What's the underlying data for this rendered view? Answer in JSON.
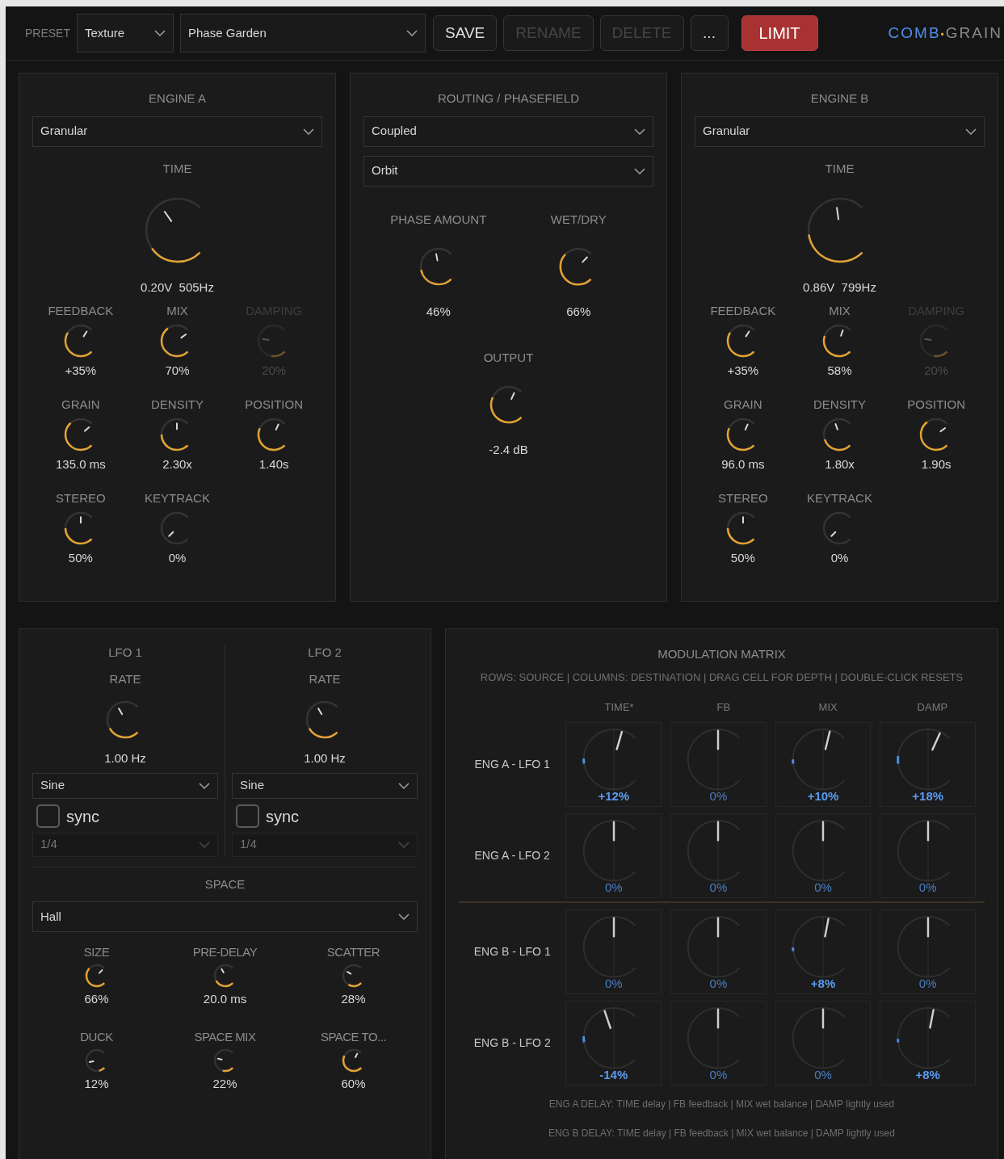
{
  "top_bar": {
    "preset_label": "PRESET",
    "bank": "Texture",
    "preset": "Phase Garden",
    "buttons": [
      {
        "label": "SAVE",
        "kind": "normal",
        "disabled": false
      },
      {
        "label": "RENAME",
        "kind": "normal",
        "disabled": true
      },
      {
        "label": "DELETE",
        "kind": "normal",
        "disabled": true
      },
      {
        "label": "...",
        "kind": "normal",
        "disabled": false
      },
      {
        "label": "LIMIT",
        "kind": "alert",
        "disabled": false
      }
    ],
    "logo": {
      "left": "COMB",
      "separator": "•",
      "right": "GRAIN"
    }
  },
  "engines": [
    {
      "title": "ENGINE A",
      "mode": "Granular",
      "time": {
        "label": "TIME",
        "value": "0.20V  505Hz"
      },
      "knobs": [
        {
          "label": "FEEDBACK",
          "value": "+35%",
          "disabled": false
        },
        {
          "label": "MIX",
          "value": "70%",
          "disabled": false
        },
        {
          "label": "DAMPING",
          "value": "20%",
          "disabled": true
        },
        {
          "label": "GRAIN",
          "value": "135.0 ms",
          "disabled": false
        },
        {
          "label": "DENSITY",
          "value": "2.30x",
          "disabled": false
        },
        {
          "label": "POSITION",
          "value": "1.40s",
          "disabled": false
        },
        {
          "label": "STEREO",
          "value": "50%",
          "disabled": false
        },
        {
          "label": "KEYTRACK",
          "value": "0%",
          "disabled": false
        }
      ]
    },
    {
      "title": "ENGINE B",
      "mode": "Granular",
      "time": {
        "label": "TIME",
        "value": "0.86V  799Hz"
      },
      "knobs": [
        {
          "label": "FEEDBACK",
          "value": "+35%",
          "disabled": false
        },
        {
          "label": "MIX",
          "value": "58%",
          "disabled": false
        },
        {
          "label": "DAMPING",
          "value": "20%",
          "disabled": true
        },
        {
          "label": "GRAIN",
          "value": "96.0 ms",
          "disabled": false
        },
        {
          "label": "DENSITY",
          "value": "1.80x",
          "disabled": false
        },
        {
          "label": "POSITION",
          "value": "1.90s",
          "disabled": false
        },
        {
          "label": "STEREO",
          "value": "50%",
          "disabled": false
        },
        {
          "label": "KEYTRACK",
          "value": "0%",
          "disabled": false
        }
      ]
    }
  ],
  "routing": {
    "title": "ROUTING / PHASEFIELD",
    "modes": [
      "Coupled",
      "Orbit"
    ],
    "knobs": [
      {
        "label": "PHASE AMOUNT",
        "value": "46%"
      },
      {
        "label": "WET/DRY",
        "value": "66%"
      }
    ],
    "output": {
      "label": "OUTPUT",
      "value": "-2.4 dB"
    }
  },
  "lfos": [
    {
      "title": "LFO 1",
      "rate_label": "RATE",
      "value": "1.00 Hz",
      "shape": "Sine",
      "sync": {
        "label": "sync",
        "checked": false
      },
      "division": {
        "value": "1/4",
        "disabled": true
      }
    },
    {
      "title": "LFO 2",
      "rate_label": "RATE",
      "value": "1.00 Hz",
      "shape": "Sine",
      "sync": {
        "label": "sync",
        "checked": false
      },
      "division": {
        "value": "1/4",
        "disabled": true
      }
    }
  ],
  "space": {
    "title": "SPACE",
    "type": "Hall",
    "knobs": [
      {
        "label": "SIZE",
        "value": "66%"
      },
      {
        "label": "PRE-DELAY",
        "value": "20.0 ms"
      },
      {
        "label": "SCATTER",
        "value": "28%"
      },
      {
        "label": "DUCK",
        "value": "12%"
      },
      {
        "label": "SPACE MIX",
        "value": "22%"
      },
      {
        "label": "SPACE TO...",
        "value": "60%"
      }
    ]
  },
  "mod_matrix": {
    "title": "MODULATION MATRIX",
    "hint": "ROWS: SOURCE | COLUMNS: DESTINATION | DRAG CELL FOR DEPTH | DOUBLE-CLICK RESETS",
    "columns": [
      "TIME*",
      "FB",
      "MIX",
      "DAMP"
    ],
    "rows": [
      {
        "source": "ENG A - LFO 1",
        "cells": [
          {
            "value": "+12%"
          },
          {
            "value": "0%"
          },
          {
            "value": "+10%"
          },
          {
            "value": "+18%"
          }
        ]
      },
      {
        "source": "ENG A - LFO 2",
        "cells": [
          {
            "value": "0%"
          },
          {
            "value": "0%"
          },
          {
            "value": "0%"
          },
          {
            "value": "0%"
          }
        ]
      },
      {
        "source": "ENG B - LFO 1",
        "cells": [
          {
            "value": "0%"
          },
          {
            "value": "0%"
          },
          {
            "value": "+8%"
          },
          {
            "value": "0%"
          }
        ]
      },
      {
        "source": "ENG B - LFO 2",
        "cells": [
          {
            "value": "-14%"
          },
          {
            "value": "0%"
          },
          {
            "value": "0%"
          },
          {
            "value": "+8%"
          }
        ]
      }
    ],
    "notes": [
      "ENG A DELAY: TIME delay | FB feedback | MIX wet balance | DAMP lightly used",
      "ENG B DELAY: TIME delay | FB feedback | MIX wet balance | DAMP lightly used"
    ]
  }
}
